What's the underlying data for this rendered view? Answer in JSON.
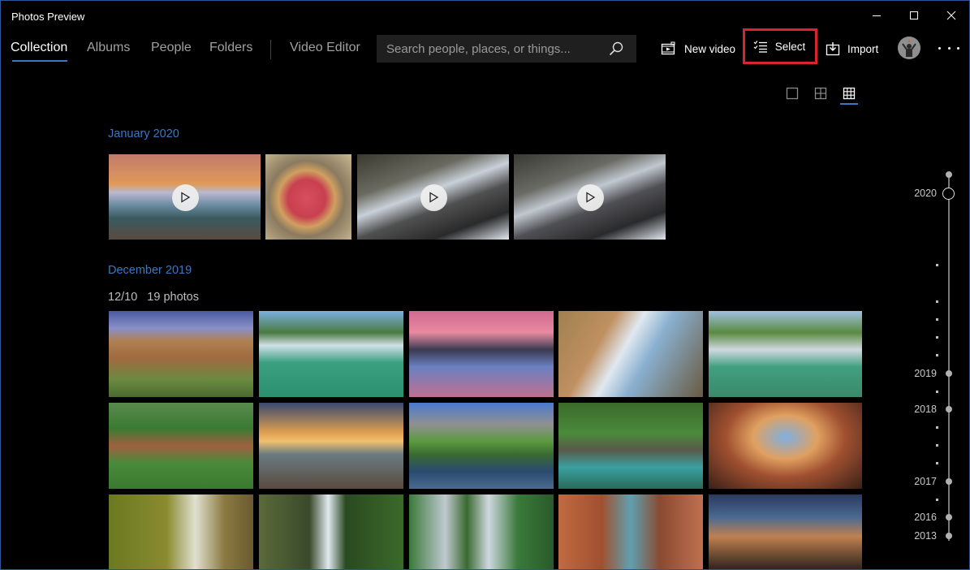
{
  "window": {
    "title": "Photos Preview",
    "controls": [
      "minimize",
      "maximize",
      "close"
    ]
  },
  "nav": {
    "tabs": [
      {
        "label": "Collection",
        "active": true
      },
      {
        "label": "Albums",
        "active": false
      },
      {
        "label": "People",
        "active": false
      },
      {
        "label": "Folders",
        "active": false
      },
      {
        "label": "Video Editor",
        "active": false
      }
    ]
  },
  "search": {
    "placeholder": "Search people, places, or things...",
    "value": "",
    "icon": "search-icon"
  },
  "toolbar": {
    "new_video_label": "New video",
    "select_label": "Select",
    "import_label": "Import",
    "more_label": "...",
    "highlight_color": "#d9232d"
  },
  "view_modes": [
    {
      "name": "large",
      "active": false
    },
    {
      "name": "medium",
      "active": false
    },
    {
      "name": "small",
      "active": true
    }
  ],
  "accent_color": "#3a78c4",
  "sections": [
    {
      "title": "January 2020",
      "items": [
        {
          "subject": "iceberg reflection at sunset",
          "type": "video"
        },
        {
          "subject": "red apple on straw",
          "type": "photo"
        },
        {
          "subject": "stream over rocks",
          "type": "video"
        },
        {
          "subject": "stream over rocks",
          "type": "video"
        }
      ]
    },
    {
      "title": "December 2019",
      "date": "12/10",
      "count": "19 photos",
      "items": [
        {
          "subject": "canyon waterfall",
          "type": "photo"
        },
        {
          "subject": "green lagoon waterfall",
          "type": "photo"
        },
        {
          "subject": "pink sunset terraced falls",
          "type": "photo"
        },
        {
          "subject": "coastal cliff waterfall",
          "type": "photo"
        },
        {
          "subject": "tiered waterfall lake",
          "type": "photo"
        },
        {
          "subject": "forest valley waterfall",
          "type": "photo"
        },
        {
          "subject": "beach sunset waterfall",
          "type": "photo"
        },
        {
          "subject": "mountain lake reflection",
          "type": "photo"
        },
        {
          "subject": "jungle pool waterfall",
          "type": "photo"
        },
        {
          "subject": "cave waterfall sunset",
          "type": "photo"
        },
        {
          "subject": "autumn forest waterfall",
          "type": "photo"
        },
        {
          "subject": "grotto waterfall",
          "type": "photo"
        },
        {
          "subject": "twin jungle waterfalls",
          "type": "photo"
        },
        {
          "subject": "canyon slot waterfall",
          "type": "photo"
        },
        {
          "subject": "cliff at dusk",
          "type": "photo"
        }
      ]
    }
  ],
  "timeline": {
    "current": "2020",
    "years": [
      "2020",
      "2019",
      "2018",
      "2017",
      "2016",
      "2013"
    ]
  }
}
